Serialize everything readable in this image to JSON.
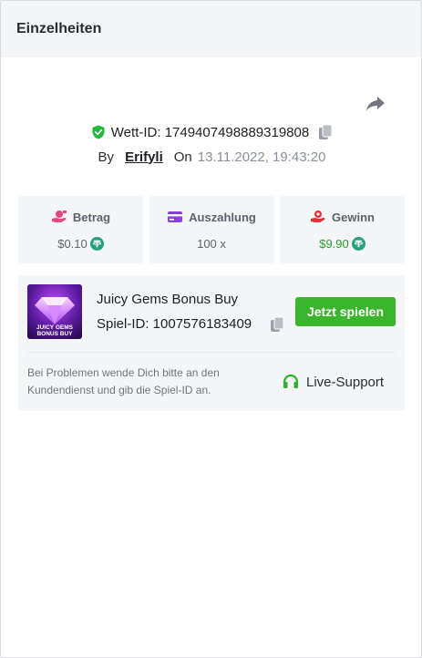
{
  "header": {
    "title": "Einzelheiten"
  },
  "bet": {
    "id_label": "Wett-ID: 1749407498889319808",
    "by_label": "By",
    "user": "Erifyli",
    "on_label": "On",
    "date": "13.11.2022, 19:43:20"
  },
  "stats": [
    {
      "label": "Betrag",
      "value": "$0.10",
      "icon": "money-hand-icon",
      "currency_icon": "tether-icon"
    },
    {
      "label": "Auszahlung",
      "value": "100 x",
      "icon": "card-icon"
    },
    {
      "label": "Gewinn",
      "value": "$9.90",
      "icon": "coin-hand-icon",
      "currency_icon": "tether-icon"
    }
  ],
  "game": {
    "title": "Juicy Gems Bonus Buy",
    "spiel_id": "Spiel-ID: 1007576183409",
    "thumb_text_line1": "JUICY GEMS",
    "thumb_text_line2": "BONUS BUY",
    "play_label": "Jetzt spielen",
    "help_text": "Bei Problemen wende Dich bitte an den Kundendienst und gib die Spiel-ID an.",
    "support_label": "Live-Support"
  },
  "colors": {
    "accent_green": "#3bb52e",
    "win_green": "#2a9d2e",
    "tether": "#26a17b",
    "betrag_pink": "#e8467c",
    "auszahlung_purple": "#8b3fe0",
    "gewinn_red": "#e0323a"
  }
}
